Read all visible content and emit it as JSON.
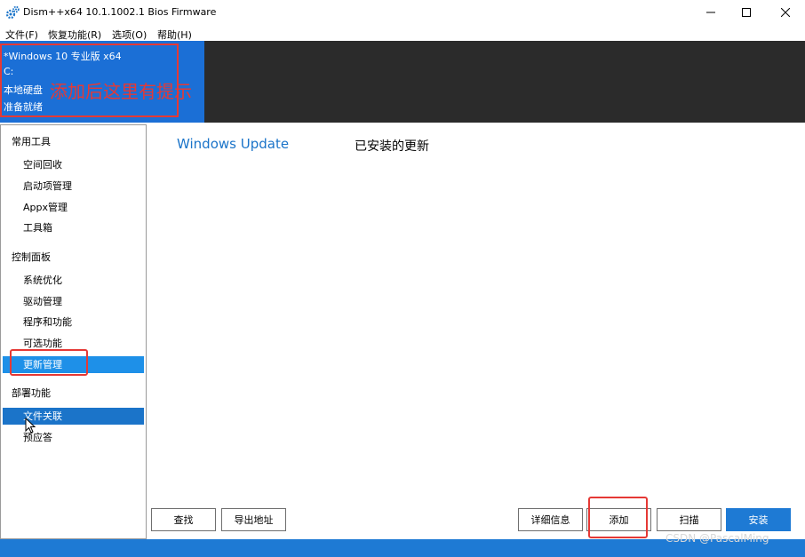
{
  "window": {
    "title": "Dism++x64 10.1.1002.1 Bios Firmware"
  },
  "menu": [
    {
      "label": "文件(F)"
    },
    {
      "label": "恢复功能(R)"
    },
    {
      "label": "选项(O)"
    },
    {
      "label": "帮助(H)"
    }
  ],
  "header": {
    "os": "*Windows 10 专业版 x64",
    "drive": "C:",
    "disk": "本地硬盘",
    "status": "准备就绪",
    "hint_annotation": "添加后这里有提示"
  },
  "sidebar": {
    "sections": [
      {
        "title": "常用工具",
        "items": [
          "空间回收",
          "启动项管理",
          "Appx管理",
          "工具箱"
        ]
      },
      {
        "title": "控制面板",
        "items": [
          "系统优化",
          "驱动管理",
          "程序和功能",
          "可选功能",
          "更新管理"
        ]
      },
      {
        "title": "部署功能",
        "items": [
          "文件关联",
          "预应答"
        ]
      }
    ],
    "selected": "更新管理",
    "hovered": "文件关联"
  },
  "main": {
    "tab_title": "Windows Update",
    "tab_subtitle": "已安装的更新"
  },
  "buttons": {
    "find": "查找",
    "export": "导出地址",
    "details": "详细信息",
    "add": "添加",
    "scan": "扫描",
    "install": "安装"
  },
  "watermark": "CSDN @PascalMing",
  "colors": {
    "accent": "#1e7ad4",
    "selected": "#1e90e8",
    "header_dark": "#2b2b2b",
    "annotation_red": "#e53935"
  }
}
